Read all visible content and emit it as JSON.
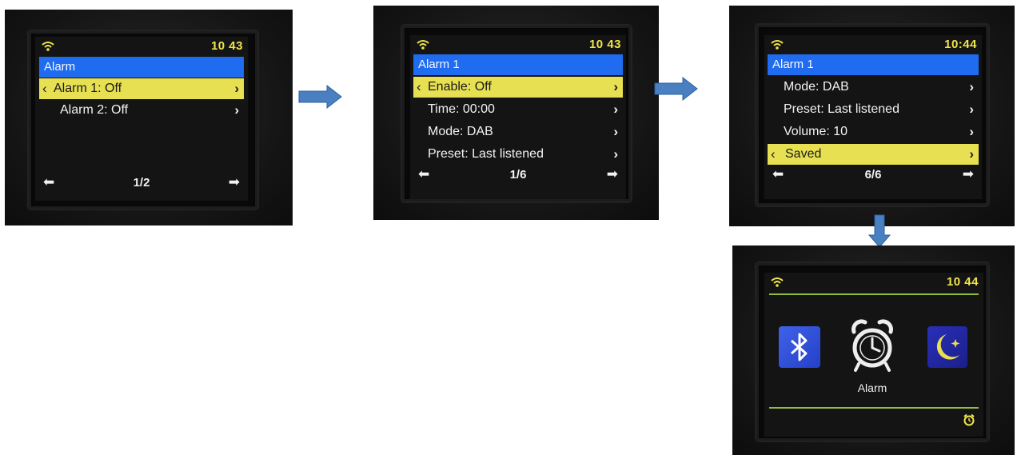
{
  "colors": {
    "title_bar": "#1f6cf0",
    "selected_row": "#e6e052",
    "clock": "#f0e64a",
    "flow_arrow": "#4a7fc1",
    "divider": "#8fbf3a"
  },
  "screen1": {
    "clock": "10 43",
    "title": "Alarm",
    "rows": [
      {
        "label": "Alarm 1: Off"
      },
      {
        "label": "Alarm 2: Off"
      }
    ],
    "page": "1/2"
  },
  "screen2": {
    "clock": "10 43",
    "title": "Alarm 1",
    "rows": [
      {
        "label": "Enable: Off"
      },
      {
        "label": "Time: 00:00"
      },
      {
        "label": "Mode: DAB"
      },
      {
        "label": "Preset: Last listened"
      }
    ],
    "page": "1/6"
  },
  "screen3": {
    "clock": "10:44",
    "title": "Alarm 1",
    "rows": [
      {
        "label": "Mode: DAB"
      },
      {
        "label": "Preset: Last listened"
      },
      {
        "label": "Volume: 10"
      },
      {
        "label": "Saved"
      }
    ],
    "page": "6/6"
  },
  "screen4": {
    "clock": "10 44",
    "caption": "Alarm",
    "icons": [
      "bluetooth-icon",
      "alarm-clock-icon",
      "sleep-moon-icon",
      "small-alarm-icon"
    ]
  },
  "glyphs": {
    "back": "‹",
    "forward": "›",
    "left_arrow": "⬅",
    "right_arrow": "➡"
  }
}
